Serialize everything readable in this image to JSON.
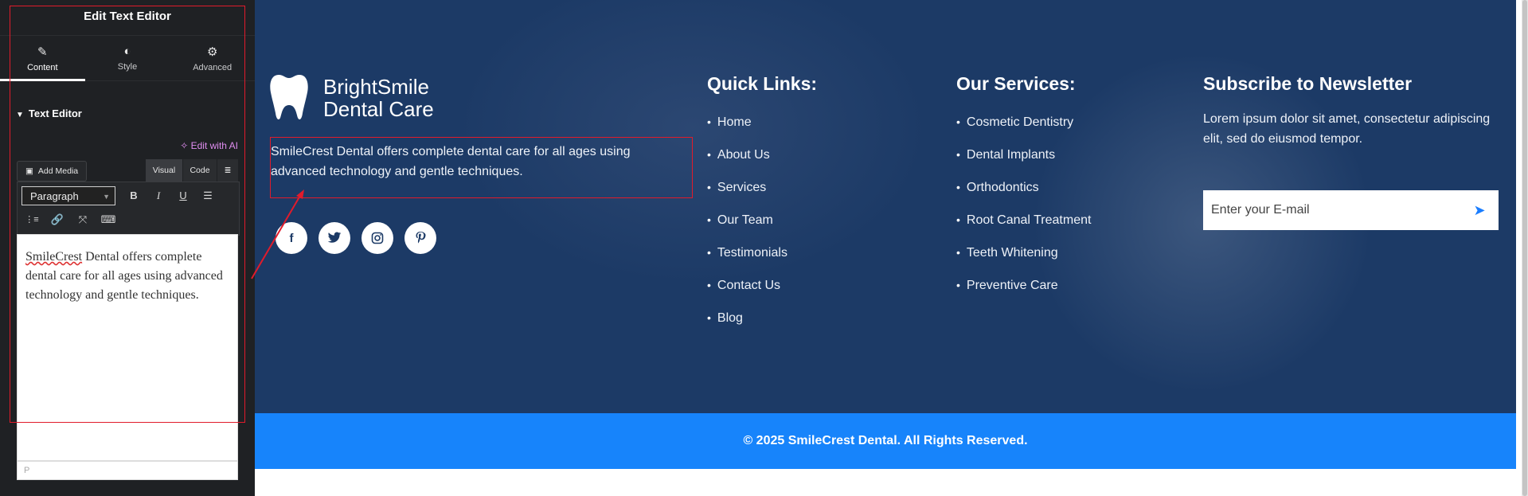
{
  "panel": {
    "title": "Edit Text Editor",
    "tabs": [
      {
        "label": "Content",
        "icon": "pencil-icon"
      },
      {
        "label": "Style",
        "icon": "contrast-icon"
      },
      {
        "label": "Advanced",
        "icon": "gear-icon"
      }
    ],
    "section_title": "Text Editor",
    "edit_ai": "Edit with AI",
    "add_media": "Add Media",
    "mode_visual": "Visual",
    "mode_code": "Code",
    "format_select": "Paragraph",
    "editor_content_prefix": "SmileCrest",
    "editor_content_rest": " Dental offers complete dental care for all ages using advanced technology and gentle techniques.",
    "editor_path": "P"
  },
  "footer": {
    "brand_line1": "BrightSmile",
    "brand_line2": "Dental Care",
    "about": "SmileCrest Dental offers complete dental care for all ages using advanced technology and gentle techniques.",
    "socials": [
      "facebook-icon",
      "twitter-icon",
      "instagram-icon",
      "pinterest-icon"
    ],
    "quick_links_title": "Quick Links:",
    "quick_links": [
      "Home",
      "About Us",
      "Services",
      "Our Team",
      "Testimonials",
      "Contact Us",
      "Blog"
    ],
    "services_title": "Our Services:",
    "services": [
      "Cosmetic Dentistry",
      "Dental Implants",
      "Orthodontics",
      "Root Canal Treatment",
      "Teeth Whitening",
      "Preventive Care"
    ],
    "newsletter_title": "Subscribe to Newsletter",
    "newsletter_text": "Lorem ipsum dolor sit amet, consectetur adipiscing elit, sed do eiusmod tempor.",
    "email_placeholder": "Enter your E-mail",
    "copyright": "© 2025 SmileCrest Dental. All Rights Reserved."
  },
  "colors": {
    "panel_bg": "#1f2124",
    "footer_bg": "#1c3a66",
    "copyright_bg": "#1784fb",
    "highlight": "#e11b2b",
    "ai_accent": "#e08df0"
  }
}
